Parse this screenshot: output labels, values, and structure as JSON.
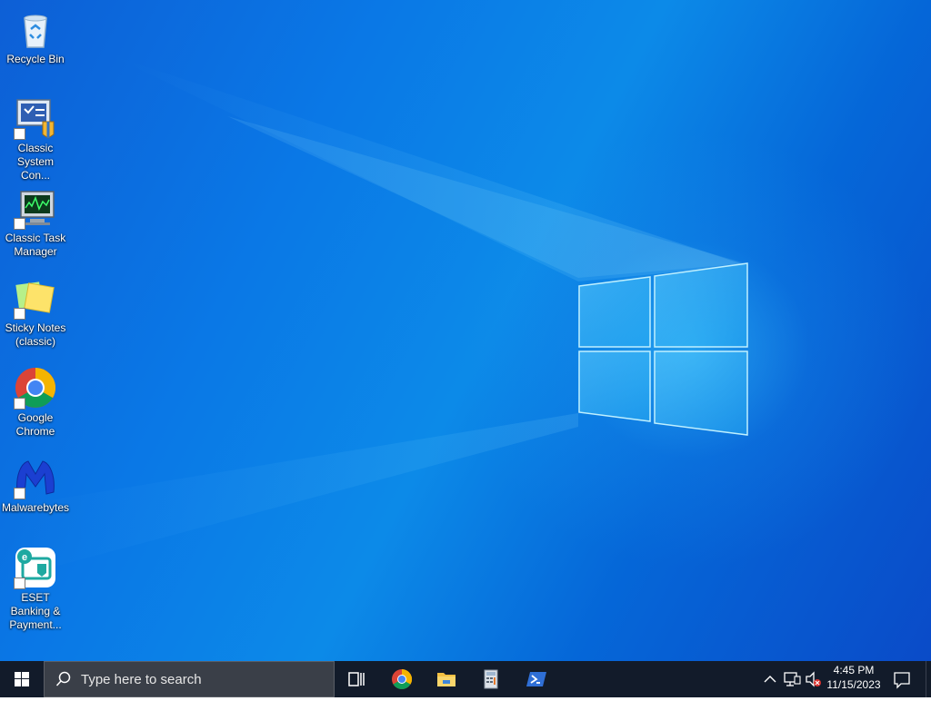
{
  "desktop": {
    "icons": [
      {
        "name": "recycle-bin",
        "label": "Recycle Bin",
        "icon": "recycle-bin-icon"
      },
      {
        "name": "classic-system-control",
        "label": "Classic System Con...",
        "icon": "control-panel-icon"
      },
      {
        "name": "classic-task-manager",
        "label": "Classic Task Manager",
        "icon": "task-manager-icon"
      },
      {
        "name": "sticky-notes-classic",
        "label": "Sticky Notes (classic)",
        "icon": "sticky-notes-icon"
      },
      {
        "name": "google-chrome",
        "label": "Google Chrome",
        "icon": "chrome-icon"
      },
      {
        "name": "malwarebytes",
        "label": "Malwarebytes",
        "icon": "malwarebytes-icon"
      },
      {
        "name": "eset-banking",
        "label": "ESET Banking & Payment...",
        "icon": "eset-icon"
      }
    ]
  },
  "taskbar": {
    "search_placeholder": "Type here to search",
    "pinned": [
      {
        "name": "task-view",
        "icon": "task-view-icon"
      },
      {
        "name": "chrome",
        "icon": "chrome-icon"
      },
      {
        "name": "file-explorer",
        "icon": "folder-icon"
      },
      {
        "name": "calculator",
        "icon": "calculator-icon"
      },
      {
        "name": "powershell",
        "icon": "powershell-icon"
      }
    ],
    "tray": {
      "time": "4:45 PM",
      "date": "11/15/2023"
    }
  },
  "colors": {
    "taskbar_bg": "#121b2a",
    "desktop_accent": "#0a78e6",
    "search_bg": "#3a3f48"
  }
}
